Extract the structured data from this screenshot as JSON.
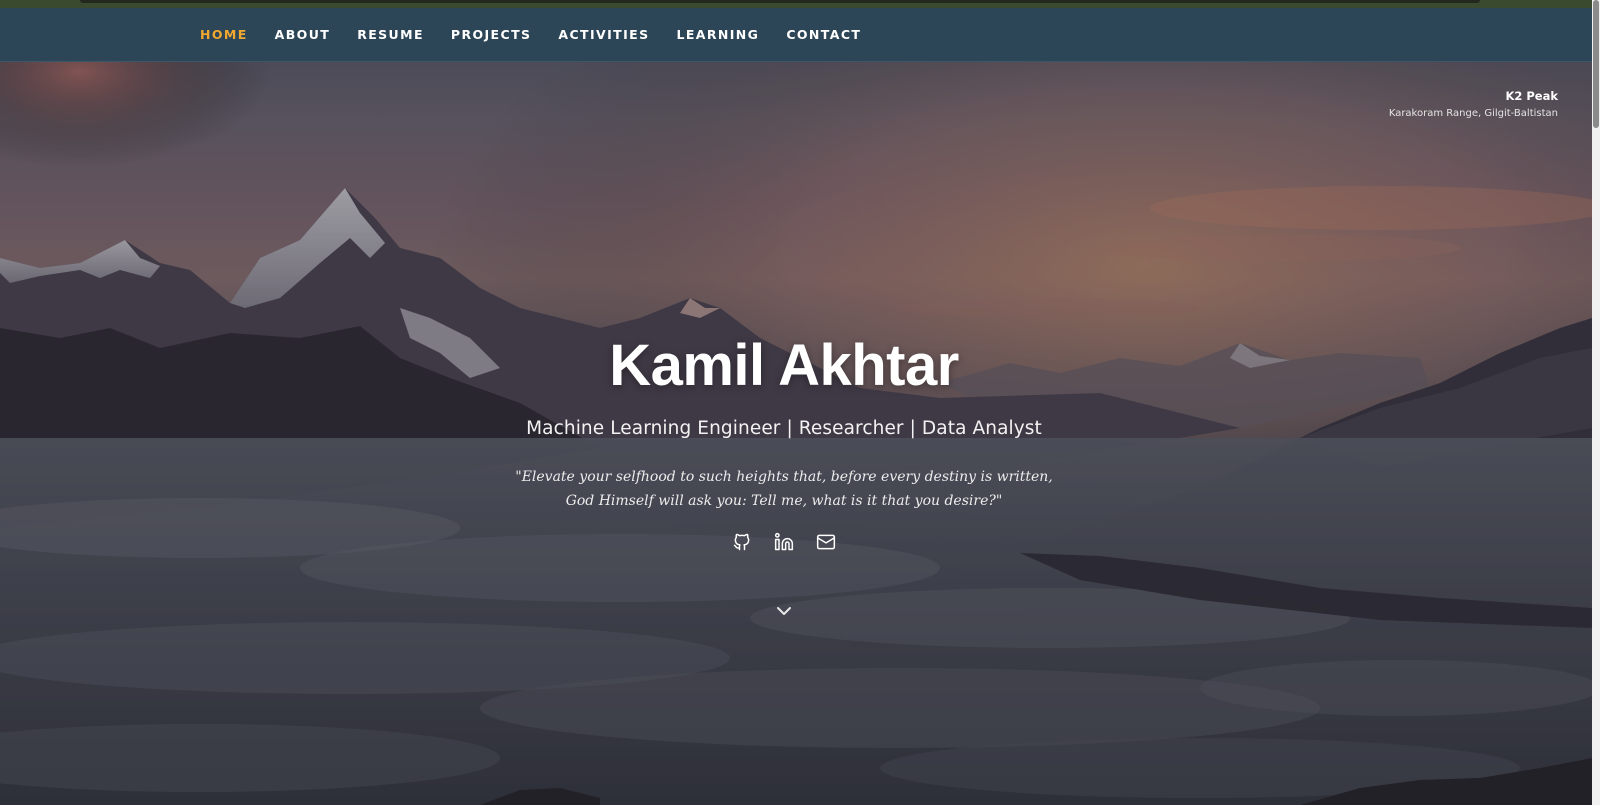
{
  "nav": {
    "items": [
      {
        "label": "HOME",
        "active": true
      },
      {
        "label": "ABOUT",
        "active": false
      },
      {
        "label": "RESUME",
        "active": false
      },
      {
        "label": "PROJECTS",
        "active": false
      },
      {
        "label": "ACTIVITIES",
        "active": false
      },
      {
        "label": "LEARNING",
        "active": false
      },
      {
        "label": "CONTACT",
        "active": false
      }
    ],
    "active_color": "#f0a830",
    "background": "#2d4657"
  },
  "photo_caption": {
    "title": "K2 Peak",
    "location": "Karakoram Range, Gilgit-Baltistan"
  },
  "hero": {
    "name": "Kamil Akhtar",
    "subtitle": "Machine Learning Engineer | Researcher | Data Analyst",
    "quote_line1": "\"Elevate your selfhood to such heights that, before every destiny is written,",
    "quote_line2": "God Himself will ask you: Tell me, what is it that you desire?\""
  },
  "socials": [
    {
      "icon": "github-icon"
    },
    {
      "icon": "linkedin-icon"
    },
    {
      "icon": "mail-icon"
    }
  ],
  "scroll_indicator": {
    "icon": "chevron-down-icon"
  }
}
